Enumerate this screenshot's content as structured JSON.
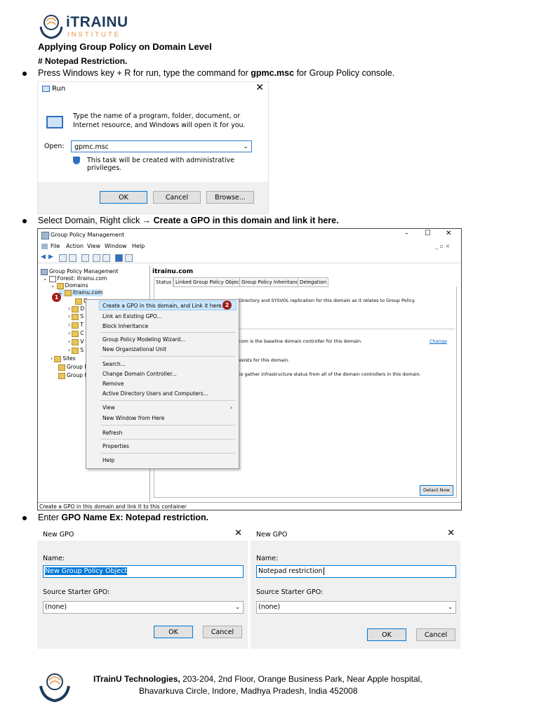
{
  "logo": {
    "brand": "iTRAINU",
    "sub": "INSTITUTE"
  },
  "doc": {
    "heading": "Applying Group Policy on Domain Level",
    "subheading": "# Notepad Restriction.",
    "step1": {
      "pre": "Press Windows key + R for run, type the command for ",
      "bold": "gpmc.msc",
      "post": " for Group Policy console."
    },
    "step2": {
      "pre": "Select Domain, Right click ",
      "bold": "→ Create a GPO in this domain and link it here."
    },
    "step3": {
      "pre": "Enter ",
      "bold": "GPO Name Ex: Notepad restriction."
    }
  },
  "run_dialog": {
    "title": "Run",
    "close": "✕",
    "description": "Type the name of a program, folder, document, or Internet resource, and Windows will open it for you.",
    "open_label": "Open:",
    "open_value": "gpmc.msc",
    "admin_note": "This task will be created with administrative privileges.",
    "ok": "OK",
    "cancel": "Cancel",
    "browse": "Browse..."
  },
  "gpm": {
    "title": "Group Policy Management",
    "win_controls": [
      "–",
      "☐",
      "✕"
    ],
    "menus": [
      "File",
      "Action",
      "View",
      "Window",
      "Help"
    ],
    "tree": {
      "root": "Group Policy Management",
      "forest": "Forest: itrainu.com",
      "domains": "Domains",
      "domain": "itrainu.com",
      "children": [
        "D",
        "D",
        "S",
        "T",
        "C",
        "V",
        "S"
      ],
      "sites": "Sites",
      "gp1": "Group P",
      "gp2": "Group P"
    },
    "right_title": "itrainu.com",
    "tabs": [
      "Status",
      "Linked Group Policy Objects",
      "Group Policy Inheritance",
      "Delegation"
    ],
    "status_lines": [
      "Directory and SYSVOL replication for this domain as it relates to Group Policy.",
      "com is the baseline domain controller for this domain.",
      "exists for this domain.",
      "to gather infrastructure status from all of the domain controllers in this domain."
    ],
    "change_link": "Change",
    "detect_now": "Detect Now",
    "context_menu": [
      "Create a GPO in this domain, and Link it here...",
      "Link an Existing GPO...",
      "Block Inheritance",
      "Group Policy Modeling Wizard...",
      "New Organizational Unit",
      "Search...",
      "Change Domain Controller...",
      "Remove",
      "Active Directory Users and Computers...",
      "View",
      "New Window from Here",
      "Refresh",
      "Properties",
      "Help"
    ],
    "status_bar": "Create a GPO in this domain and link it to this container",
    "badge1": "1",
    "badge2": "2"
  },
  "new_gpo_left": {
    "title": "New GPO",
    "name_label": "Name:",
    "name_value": "New Group Policy Object",
    "starter_label": "Source Starter GPO:",
    "starter_value": "(none)",
    "ok": "OK",
    "cancel": "Cancel"
  },
  "new_gpo_right": {
    "title": "New GPO",
    "name_label": "Name:",
    "name_value": "Notepad restriction",
    "starter_label": "Source Starter GPO:",
    "starter_value": "(none)",
    "ok": "OK",
    "cancel": "Cancel"
  },
  "footer": {
    "company": "ITrainU Technologies,",
    "address1": " 203-204, 2nd Floor, Orange Business Park, Near Apple hospital,",
    "address2": "Bhavarkuva Circle, Indore, Madhya Pradesh, India 452008"
  },
  "colors": {
    "brand": "#1f3b5a",
    "accent": "#e6913a",
    "badge": "#a01a1a",
    "selection": "#cce8ff"
  }
}
